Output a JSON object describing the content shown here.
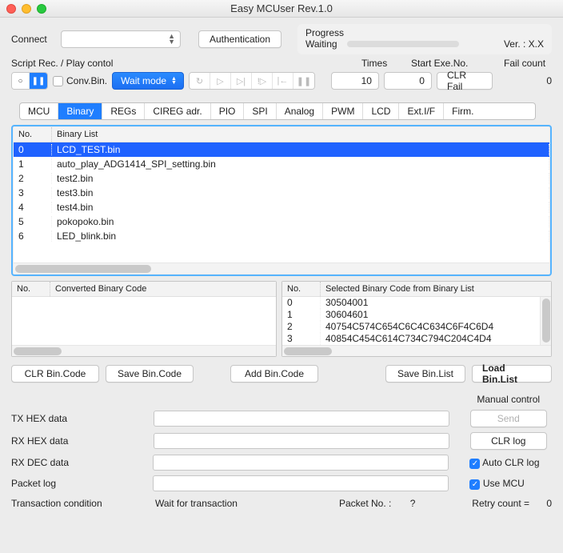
{
  "window": {
    "title": "Easy MCUser Rev.1.0"
  },
  "toolbar": {
    "connect_label": "Connect",
    "auth_label": "Authentication",
    "progress_label": "Progress",
    "waiting_label": "Waiting",
    "version_label": "Ver. : X.X"
  },
  "script": {
    "header": "Script Rec. / Play contol",
    "times_label": "Times",
    "start_label": "Start Exe.No.",
    "failcount_label": "Fail count",
    "convbin_label": "Conv.Bin.",
    "mode_label": "Wait mode",
    "times_value": "10",
    "start_value": "0",
    "clrfail_label": "CLR Fail",
    "fail_value": "0"
  },
  "tabs": [
    "MCU",
    "Binary",
    "REGs",
    "CIREG adr.",
    "PIO",
    "SPI",
    "Analog",
    "PWM",
    "LCD",
    "Ext.I/F",
    "Firm."
  ],
  "active_tab": 1,
  "binary_list": {
    "col_no": "No.",
    "col_name": "Binary List",
    "rows": [
      {
        "no": "0",
        "name": "LCD_TEST.bin"
      },
      {
        "no": "1",
        "name": "auto_play_ADG1414_SPI_setting.bin"
      },
      {
        "no": "2",
        "name": "test2.bin"
      },
      {
        "no": "3",
        "name": "test3.bin"
      },
      {
        "no": "4",
        "name": "test4.bin"
      },
      {
        "no": "5",
        "name": "pokopoko.bin"
      },
      {
        "no": "6",
        "name": "LED_blink.bin"
      }
    ],
    "selected": 0
  },
  "conv_panel": {
    "col_no": "No.",
    "col_name": "Converted Binary Code"
  },
  "sel_panel": {
    "col_no": "No.",
    "col_name": "Selected Binary Code from Binary List",
    "rows": [
      {
        "no": "0",
        "code": "30504001"
      },
      {
        "no": "1",
        "code": "30604601"
      },
      {
        "no": "2",
        "code": "40754C574C654C6C4C634C6F4C6D4"
      },
      {
        "no": "3",
        "code": "40854C454C614C734C794C204C4D4"
      }
    ]
  },
  "buttons": {
    "clrbin": "CLR Bin.Code",
    "savebin": "Save Bin.Code",
    "addbin": "Add Bin.Code",
    "savelist": "Save Bin.List",
    "loadlist": "Load Bin.List"
  },
  "lower": {
    "txhex": "TX HEX data",
    "rxhex": "RX HEX data",
    "rxdec": "RX DEC data",
    "packetlog": "Packet log",
    "manual": "Manual control",
    "send": "Send",
    "clrlog": "CLR log",
    "autoclr": "Auto CLR log",
    "usemcu": "Use MCU",
    "transcond": "Transaction condition",
    "wait": "Wait for transaction",
    "packetno_label": "Packet No. :",
    "packetno_val": "?",
    "retry_label": "Retry count  =",
    "retry_val": "0"
  }
}
